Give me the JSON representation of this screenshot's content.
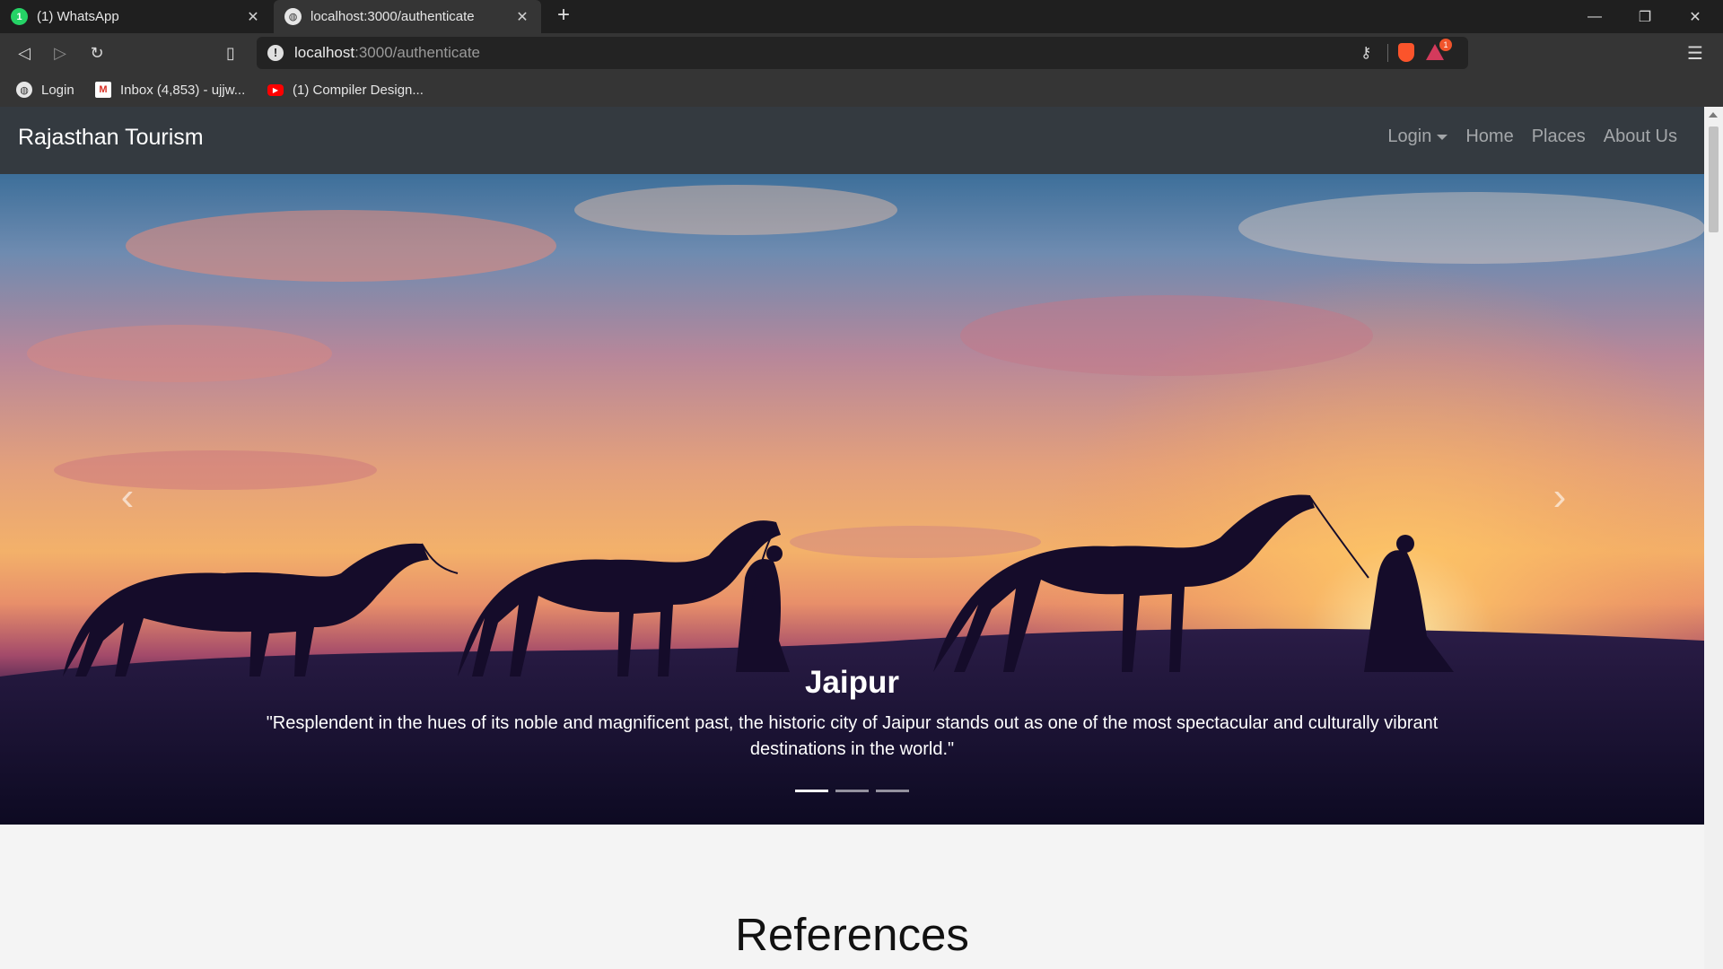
{
  "browser": {
    "tabs": [
      {
        "title": "(1) WhatsApp",
        "badge": "1",
        "active": false
      },
      {
        "title": "localhost:3000/authenticate",
        "active": true
      }
    ],
    "url": {
      "host": "localhost",
      "path": ":3000/authenticate"
    },
    "bookmarks": [
      {
        "label": "Login"
      },
      {
        "label": "Inbox (4,853) - ujjw..."
      },
      {
        "label": "(1) Compiler Design..."
      }
    ],
    "rewards_badge": "1",
    "colors": {
      "tabstrip": "#1f1f1f",
      "toolbar": "#353535",
      "brave": "#fb542b"
    }
  },
  "site": {
    "brand": "Rajasthan Tourism",
    "nav": {
      "login": "Login",
      "home": "Home",
      "places": "Places",
      "about": "About Us"
    },
    "carousel": {
      "title": "Jaipur",
      "text": "\"Resplendent in the hues of its noble and magnificent past, the historic city of Jaipur stands out as one of the most spectacular and culturally vibrant destinations in the world.\"",
      "slide_count": 3,
      "active_slide": 1
    },
    "references_heading": "References",
    "colors": {
      "navbar": "#343a40",
      "page_bg": "#f4f4f4"
    }
  }
}
